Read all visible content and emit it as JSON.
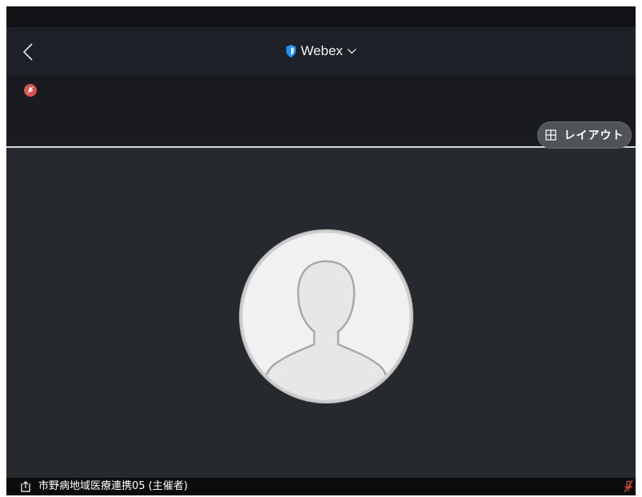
{
  "header": {
    "title": "Webex",
    "icons": {
      "back": "chevron-left-icon",
      "secure": "shield-icon",
      "dropdown": "chevron-down-icon"
    }
  },
  "status": {
    "mute_icon": "muted-mic-icon"
  },
  "controls": {
    "layout_label": "レイアウト",
    "layout_icon": "grid-icon"
  },
  "video": {
    "avatar_icon": "person-placeholder-icon"
  },
  "participant": {
    "name": "市野病地域医療連携05 (主催者)",
    "share_icon": "share-icon",
    "mute_icon": "muted-mic-icon"
  },
  "colors": {
    "background": "#1b1d22",
    "header": "#1e2128",
    "tile": "#26292e",
    "accent_blue": "#1e90ff",
    "mute_red": "#d9534f"
  }
}
